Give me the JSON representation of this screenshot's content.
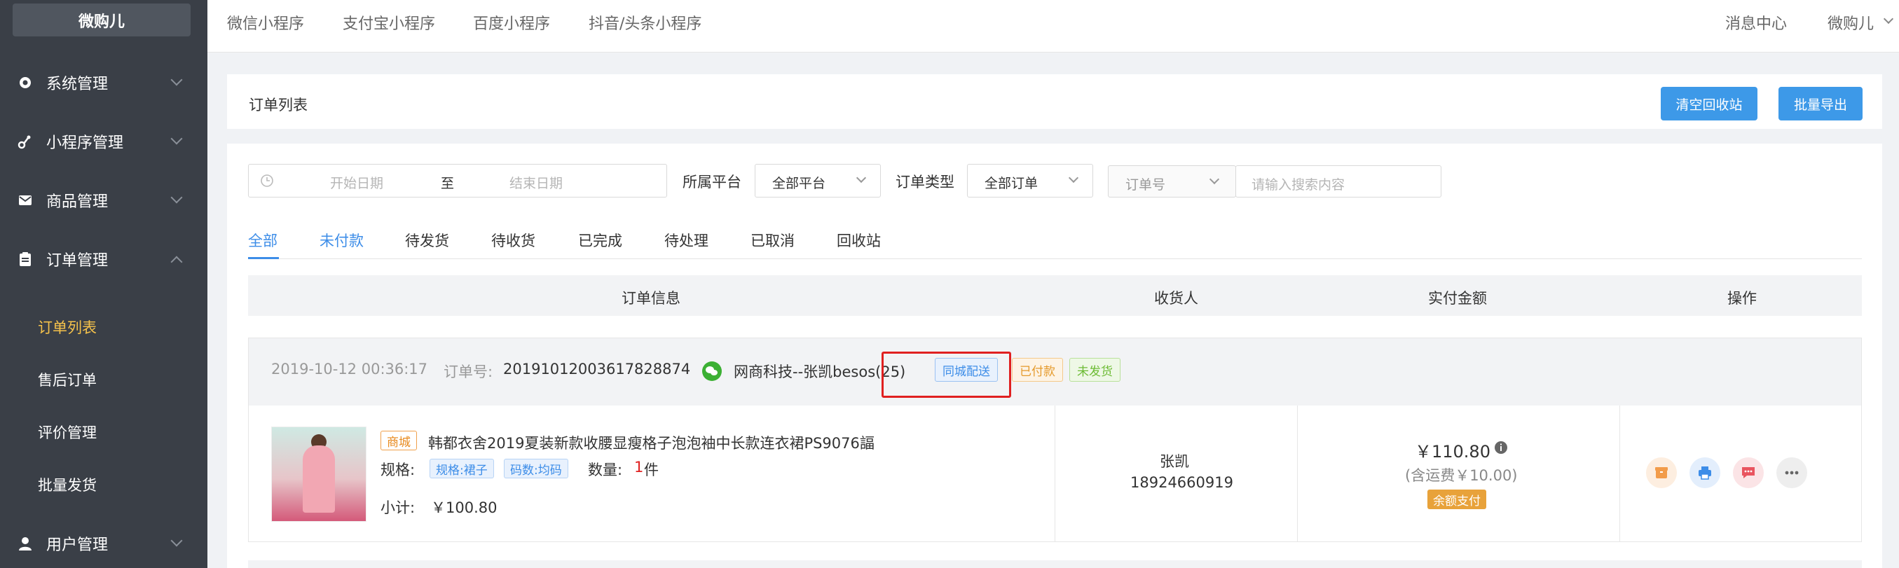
{
  "brand": "微购儿",
  "sidebar": {
    "items": [
      {
        "label": "系统管理",
        "icon": "gear-icon"
      },
      {
        "label": "小程序管理",
        "icon": "link-icon"
      },
      {
        "label": "商品管理",
        "icon": "mail-icon"
      },
      {
        "label": "订单管理",
        "icon": "clipboard-icon"
      },
      {
        "label": "用户管理",
        "icon": "user-icon"
      }
    ],
    "sub_items": [
      "订单列表",
      "售后订单",
      "评价管理",
      "批量发货"
    ]
  },
  "topnav": {
    "tabs": [
      "微信小程序",
      "支付宝小程序",
      "百度小程序",
      "抖音/头条小程序"
    ],
    "message_center": "消息中心",
    "user": "微购儿"
  },
  "page": {
    "title": "订单列表",
    "btn_clear": "清空回收站",
    "btn_export": "批量导出"
  },
  "filters": {
    "start_date": "开始日期",
    "to": "至",
    "end_date": "结束日期",
    "platform_label": "所属平台",
    "platform_value": "全部平台",
    "type_label": "订单类型",
    "type_value": "全部订单",
    "search_field": "订单号",
    "search_placeholder": "请输入搜索内容"
  },
  "tabs": [
    "全部",
    "未付款",
    "待发货",
    "待收货",
    "已完成",
    "待处理",
    "已取消",
    "回收站"
  ],
  "table_headers": [
    "订单信息",
    "收货人",
    "实付金额",
    "操作"
  ],
  "order": {
    "time": "2019-10-12 00:36:17",
    "no_label": "订单号:",
    "no": "20191012003617828874",
    "shop": "网商科技--张凯besos(25)",
    "tag_delivery": "同城配送",
    "tag_paid": "已付款",
    "tag_unshipped": "未发货",
    "product_tag": "商城",
    "product_name": "韩都衣舍2019夏装新款收腰显瘦格子泡泡袖中长款连衣裙PS9076諨",
    "spec_label": "规格:",
    "spec_1": "规格:裙子",
    "spec_2": "码数:均码",
    "qty_label": "数量:",
    "qty_value": "1",
    "qty_unit": "件",
    "subtotal_label": "小计:",
    "subtotal_value": "￥100.80",
    "receiver_name": "张凯",
    "receiver_phone": "18924660919",
    "amount": "￥110.80",
    "shipping_note": "(含运费￥10.00)",
    "pay_method": "余额支付"
  },
  "colors": {
    "sidebar_bg": "#3a3f47",
    "active_menu": "#f5c24b",
    "primary": "#3d99e8",
    "highlight_box": "#e02020"
  }
}
